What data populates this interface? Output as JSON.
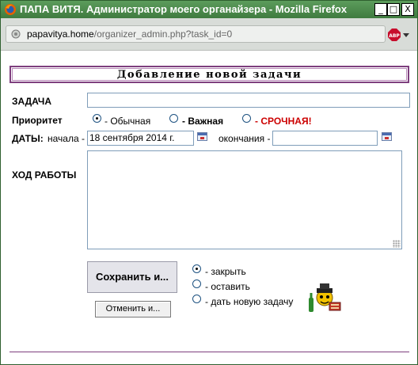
{
  "window": {
    "title": "ПАПА ВИТЯ. Администратор моего органайзера - Mozilla Firefox",
    "icon": "firefox-icon",
    "controls": {
      "minimize": "_",
      "maximize": "□",
      "close": "X"
    }
  },
  "urlbar": {
    "host": "papavitya.home",
    "path": "/organizer_admin.php?task_id=0",
    "addon_icon": "adblock-plus-icon"
  },
  "form": {
    "heading": "Добавление новой задачи",
    "task_label": "ЗАДАЧА",
    "task_value": "",
    "priority_label": "Приоритет",
    "priority_options": [
      {
        "label": "- Обычная",
        "selected": true
      },
      {
        "label": "- Важная",
        "selected": false
      },
      {
        "label": "- СРОЧНАЯ!",
        "selected": false,
        "color": "#cc0000"
      }
    ],
    "dates_label": "ДАТЫ:",
    "start_label": "начала -",
    "start_value": "18 сентября 2014 г.",
    "end_label": "окончания -",
    "end_value": "",
    "progress_label": "ХОД РАБОТЫ",
    "progress_value": "",
    "save_button": "Сохранить и...",
    "cancel_button": "Отменить и...",
    "after_save_options": [
      {
        "label": "- закрыть",
        "selected": true
      },
      {
        "label": "- оставить",
        "selected": false
      },
      {
        "label": "- дать новую задачу",
        "selected": false
      }
    ],
    "mascot_icon": "mascot-with-bottle-icon"
  },
  "colors": {
    "titlebar": "#3f7b3f",
    "heading_border": "#7e3f7e",
    "urgent": "#cc0000"
  }
}
